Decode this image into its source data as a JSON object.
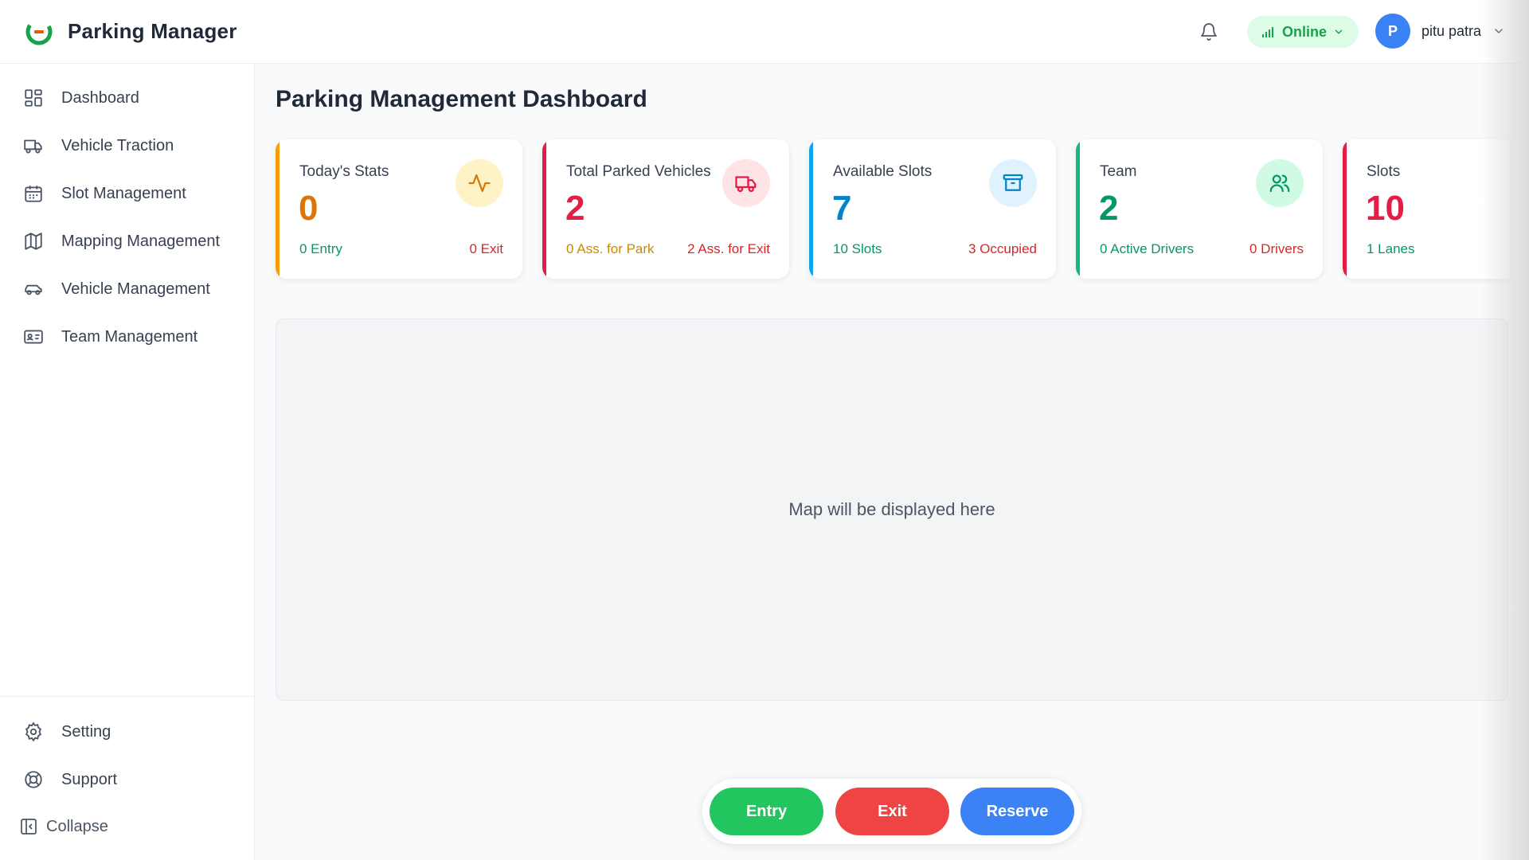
{
  "app": {
    "title": "Parking Manager"
  },
  "header": {
    "status": {
      "label": "Online",
      "color": "#16a34a"
    },
    "user": {
      "initial": "P",
      "name": "pitu patra"
    },
    "icons": [
      "bell-icon",
      "signal-icon",
      "chevron-down-icon"
    ]
  },
  "sidebar": {
    "items": [
      {
        "label": "Dashboard",
        "icon": "dashboard-icon"
      },
      {
        "label": "Vehicle Traction",
        "icon": "truck-icon"
      },
      {
        "label": "Slot Management",
        "icon": "calendar-icon"
      },
      {
        "label": "Mapping Management",
        "icon": "map-icon"
      },
      {
        "label": "Vehicle Management",
        "icon": "car-icon"
      },
      {
        "label": "Team Management",
        "icon": "id-card-icon"
      }
    ],
    "footer": [
      {
        "label": "Setting",
        "icon": "gear-icon"
      },
      {
        "label": "Support",
        "icon": "lifebuoy-icon"
      }
    ],
    "collapse_label": "Collapse"
  },
  "main": {
    "title": "Parking Management Dashboard",
    "cards": [
      {
        "title": "Today's Stats",
        "value": "0",
        "left": "0 Entry",
        "right": "0 Exit",
        "icon": "activity-icon",
        "accent": "#d97706"
      },
      {
        "title": "Total Parked Vehicles",
        "value": "2",
        "left": "0 Ass. for Park",
        "right": "2 Ass. for Exit",
        "icon": "truck-icon",
        "accent": "#e11d48"
      },
      {
        "title": "Available Slots",
        "value": "7",
        "left": "10 Slots",
        "right": "3 Occupied",
        "icon": "archive-icon",
        "accent": "#0284c7"
      },
      {
        "title": "Team",
        "value": "2",
        "left": "0 Active Drivers",
        "right": "0 Drivers",
        "icon": "users-icon",
        "accent": "#059669"
      },
      {
        "title": "Slots",
        "value": "10",
        "left": "1 Lanes",
        "right": "",
        "icon": "",
        "accent": "#e11d48"
      }
    ],
    "map_placeholder": "Map will be displayed here"
  },
  "actions": [
    {
      "label": "Entry",
      "color": "#22c55e"
    },
    {
      "label": "Exit",
      "color": "#ef4444"
    },
    {
      "label": "Reserve",
      "color": "#3b82f6"
    }
  ]
}
